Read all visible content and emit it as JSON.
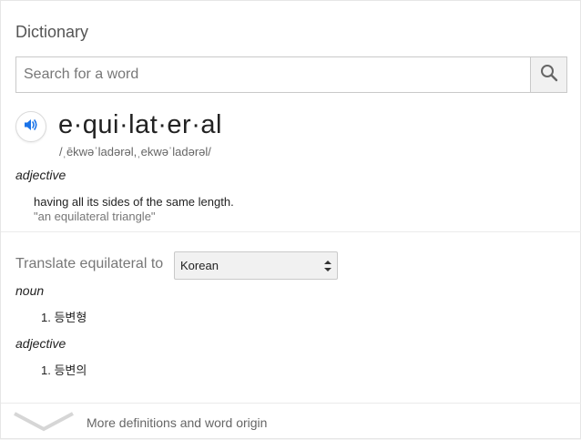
{
  "panel": {
    "title": "Dictionary",
    "search_placeholder": "Search for a word",
    "search_value": ""
  },
  "entry": {
    "word": "e·qui·lat·er·al",
    "phonetic": "/ˌēkwəˈladərəl,ˌekwəˈladərəl/",
    "part_of_speech": "adjective",
    "definition": "having all its sides of the same length.",
    "example": "\"an equilateral triangle\""
  },
  "translate": {
    "label": "Translate equilateral to",
    "selected_language": "Korean",
    "groups": [
      {
        "pos": "noun",
        "items": [
          "1. 등변형"
        ]
      },
      {
        "pos": "adjective",
        "items": [
          "1. 등변의"
        ]
      }
    ]
  },
  "footer": {
    "more_label": "More definitions and word origin"
  },
  "icons": {
    "search": "search-icon",
    "speaker": "speaker-icon",
    "select_arrows": "select-arrows-icon",
    "chevron": "chevron-down-icon"
  },
  "colors": {
    "accent_blue": "#1a73e8",
    "text": "#222222",
    "muted": "#777777"
  }
}
